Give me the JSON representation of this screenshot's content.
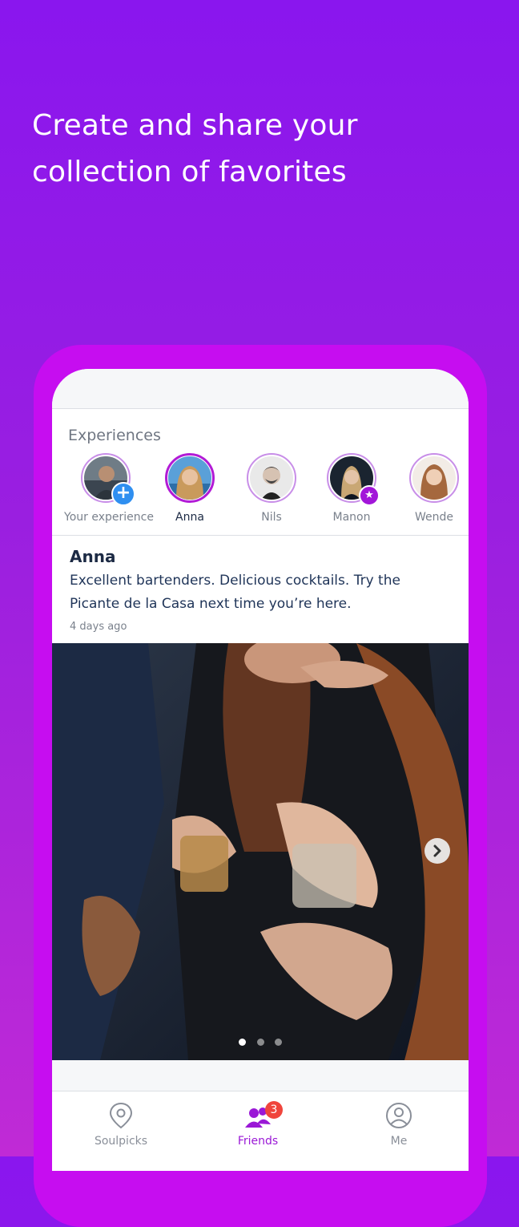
{
  "headline": {
    "line1": "Create and share your",
    "line2": "collection of favorites"
  },
  "experiences": {
    "title": "Experiences",
    "stories": [
      {
        "label": "Your experience",
        "badge": "+"
      },
      {
        "label": "Anna"
      },
      {
        "label": "Nils"
      },
      {
        "label": "Manon",
        "badge": "★"
      },
      {
        "label": "Wende"
      }
    ]
  },
  "post": {
    "author": "Anna",
    "text": "Excellent bartenders. Delicious cocktails. Try the Picante de la Casa next time you’re here.",
    "time": "4 days ago"
  },
  "tabs": {
    "soulpicks": "Soulpicks",
    "friends": "Friends",
    "friends_count": "3",
    "me": "Me"
  },
  "colors": {
    "accent": "#9a18d6",
    "badge": "#f0453c",
    "plus": "#2f8ff0"
  }
}
